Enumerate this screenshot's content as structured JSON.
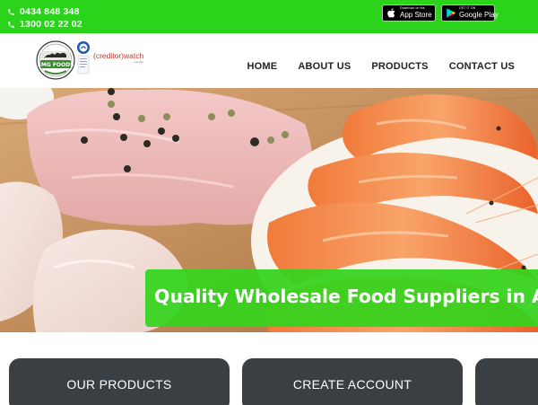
{
  "topbar": {
    "phones": [
      "0434 848 348",
      "1300 02 22 02"
    ],
    "app_store": {
      "small": "Download on the",
      "big": "App Store"
    },
    "google_play": {
      "small": "GET IT ON",
      "big": "Google Play"
    },
    "accent_color": "#2bd41b"
  },
  "header": {
    "logo_text": "SMG FOODS",
    "creditorwatch": {
      "text": "(creditor)watch",
      "sub": "member"
    },
    "nav": [
      "HOME",
      "ABOUT US",
      "PRODUCTS",
      "CONTACT US"
    ]
  },
  "hero": {
    "headline": "Quality Wholesale Food Suppliers in Australia"
  },
  "cards": [
    "OUR PRODUCTS",
    "CREATE ACCOUNT",
    ""
  ]
}
